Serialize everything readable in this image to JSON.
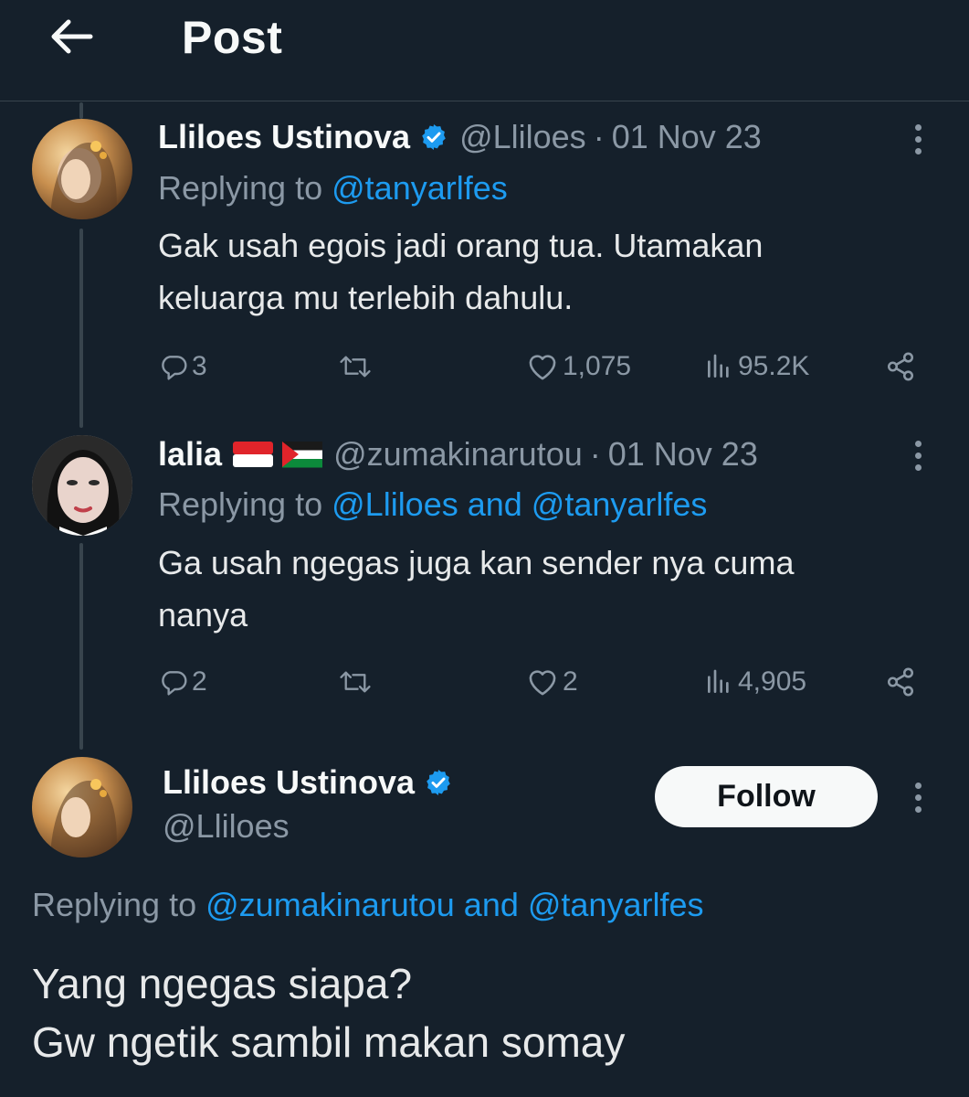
{
  "header": {
    "title": "Post",
    "back_icon": "arrow-left-icon"
  },
  "tweets": [
    {
      "name": "Lliloes Ustinova",
      "verified": true,
      "handle": "@Lliloes",
      "sep": "·",
      "date": "01 Nov 23",
      "replying_prefix": "Replying to",
      "replying_mentions": "@tanyarlfes",
      "body_lines": [
        "Gak usah egois jadi orang tua. Utamakan",
        "keluarga mu terlebih dahulu."
      ],
      "replies": "3",
      "retweets": "",
      "likes": "1,075",
      "views": "95.2K"
    },
    {
      "name": "lalia",
      "flags": [
        "indonesia-flag",
        "palestine-flag"
      ],
      "handle": "@zumakinarutou",
      "sep": "·",
      "date": "01 Nov 23",
      "replying_prefix": "Replying to",
      "replying_mentions": "@Lliloes and @tanyarlfes",
      "body_lines": [
        "Ga usah ngegas juga kan sender nya cuma",
        "nanya"
      ],
      "replies": "2",
      "retweets": "",
      "likes": "2",
      "views": "4,905"
    }
  ],
  "main_tweet": {
    "name": "Lliloes Ustinova",
    "verified": true,
    "handle": "@Lliloes",
    "follow_label": "Follow",
    "replying_prefix": "Replying to",
    "replying_mentions": "@zumakinarutou and @tanyarlfes",
    "body_lines": [
      "Yang ngegas siapa?",
      "Gw ngetik sambil makan somay"
    ]
  },
  "colors": {
    "background": "#15202b",
    "accent": "#1d9bf0",
    "muted": "#8b98a5",
    "text": "#e7e9ea"
  }
}
